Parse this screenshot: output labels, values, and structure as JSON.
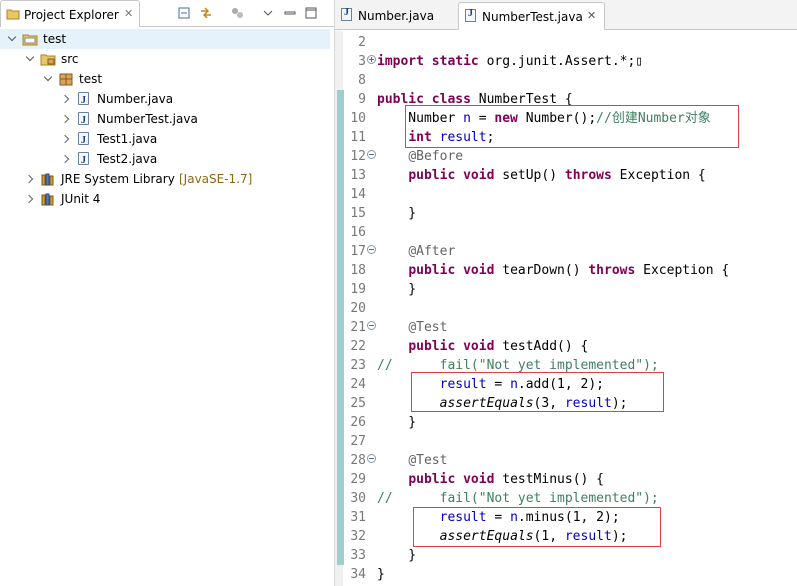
{
  "explorer": {
    "title": "Project Explorer",
    "close_glyph": "✕",
    "tree": [
      {
        "label": "test",
        "level": 0,
        "toggle": "open",
        "icon": "project-icon"
      },
      {
        "label": "src",
        "level": 1,
        "toggle": "open",
        "icon": "source-folder-icon"
      },
      {
        "label": "test",
        "level": 2,
        "toggle": "open",
        "icon": "package-icon"
      },
      {
        "label": "Number.java",
        "level": 3,
        "toggle": "closed",
        "icon": "java-file-icon"
      },
      {
        "label": "NumberTest.java",
        "level": 3,
        "toggle": "closed",
        "icon": "java-file-icon"
      },
      {
        "label": "Test1.java",
        "level": 3,
        "toggle": "closed",
        "icon": "java-file-icon"
      },
      {
        "label": "Test2.java",
        "level": 3,
        "toggle": "closed",
        "icon": "java-file-icon"
      },
      {
        "label": "JRE System Library",
        "decoration": "[JavaSE-1.7]",
        "level": 1,
        "toggle": "closed",
        "icon": "library-icon"
      },
      {
        "label": "JUnit 4",
        "level": 1,
        "toggle": "closed",
        "icon": "library-icon"
      }
    ]
  },
  "editor": {
    "tabs": [
      {
        "label": "Number.java",
        "active": false
      },
      {
        "label": "NumberTest.java",
        "active": true
      }
    ],
    "lines": [
      {
        "n": "2",
        "html": ""
      },
      {
        "n": "3",
        "fold": "plus",
        "html": "<span class='kw'>import</span> <span class='kw'>static</span> org.junit.Assert.*;▯"
      },
      {
        "n": "8",
        "html": ""
      },
      {
        "n": "9",
        "html": "<span class='kw'>public</span> <span class='kw'>class</span> NumberTest {"
      },
      {
        "n": "10",
        "html": "    Number <span class='fld'>n</span> = <span class='kw'>new</span> Number();<span class='cmt'>//创建Number对象</span>"
      },
      {
        "n": "11",
        "html": "    <span class='kw'>int</span> <span class='fld'>result</span>;"
      },
      {
        "n": "12",
        "fold": "minus",
        "html": "    <span class='ann'>@Before</span>"
      },
      {
        "n": "13",
        "html": "    <span class='kw'>public</span> <span class='kw'>void</span> setUp() <span class='kw'>throws</span> Exception {"
      },
      {
        "n": "14",
        "html": ""
      },
      {
        "n": "15",
        "html": "    }"
      },
      {
        "n": "16",
        "html": ""
      },
      {
        "n": "17",
        "fold": "minus",
        "html": "    <span class='ann'>@After</span>"
      },
      {
        "n": "18",
        "html": "    <span class='kw'>public</span> <span class='kw'>void</span> tearDown() <span class='kw'>throws</span> Exception {"
      },
      {
        "n": "19",
        "html": "    }"
      },
      {
        "n": "20",
        "html": ""
      },
      {
        "n": "21",
        "fold": "minus",
        "html": "    <span class='ann'>@Test</span>"
      },
      {
        "n": "22",
        "html": "    <span class='kw'>public</span> <span class='kw'>void</span> testAdd() {"
      },
      {
        "n": "23",
        "html": "<span class='cmt'>//      fail(\"Not yet implemented\");</span>"
      },
      {
        "n": "24",
        "html": "        <span class='fld'>result</span> = <span class='fld'>n</span>.add(1, 2);"
      },
      {
        "n": "25",
        "html": "        <span class='it'>assertEquals</span>(3, <span class='fld'>result</span>);"
      },
      {
        "n": "26",
        "html": "    }"
      },
      {
        "n": "27",
        "html": ""
      },
      {
        "n": "28",
        "fold": "minus",
        "html": "    <span class='ann'>@Test</span>"
      },
      {
        "n": "29",
        "html": "    <span class='kw'>public</span> <span class='kw'>void</span> testMinus() {"
      },
      {
        "n": "30",
        "html": "<span class='cmt'>//      fail(\"Not yet implemented\");</span>"
      },
      {
        "n": "31",
        "html": "        <span class='fld'>result</span> = <span class='fld'>n</span>.minus(1, 2);"
      },
      {
        "n": "32",
        "html": "        <span class='it'>assertEquals</span>(1, <span class='fld'>result</span>);"
      },
      {
        "n": "33",
        "html": "    }"
      },
      {
        "n": "34",
        "html": "}"
      }
    ]
  },
  "colors": {
    "keyword": "#7f0055",
    "field": "#0000c0",
    "comment": "#3f7f5f",
    "annotation": "#646464",
    "highlight_box": "#e04040"
  }
}
